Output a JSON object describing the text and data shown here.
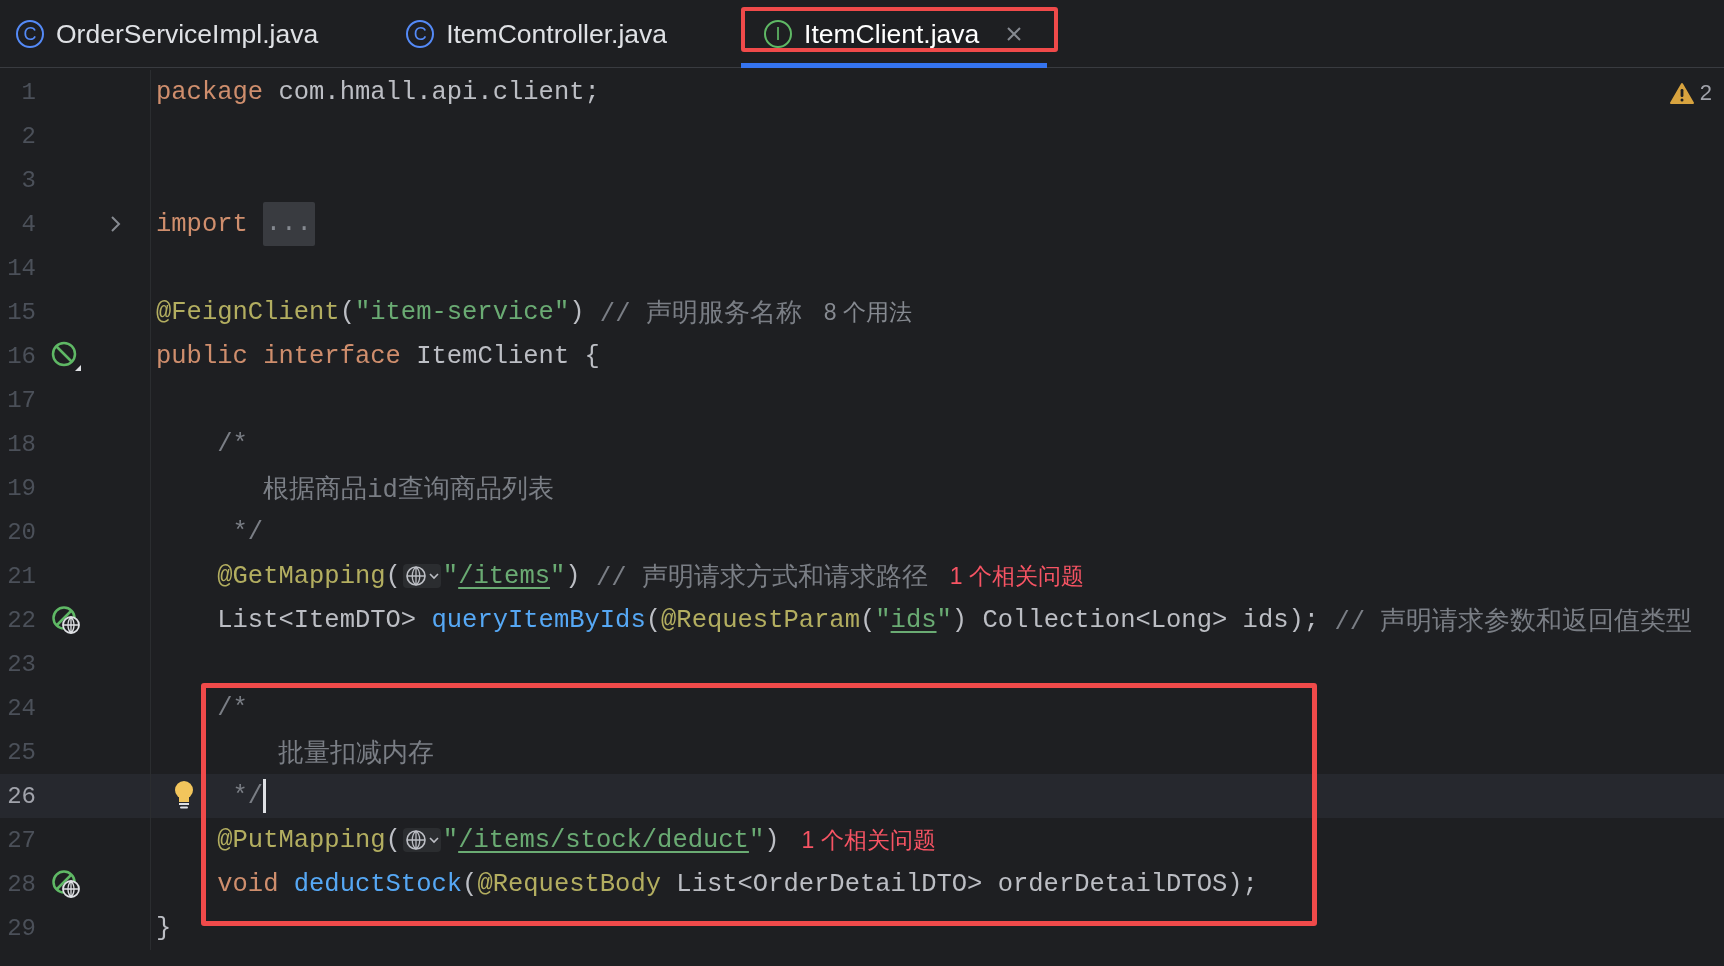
{
  "tabs": [
    {
      "kind": "class",
      "icon_letter": "C",
      "label": "OrderServiceImpl.java",
      "selected": false,
      "closable": false,
      "framed": false
    },
    {
      "kind": "class",
      "icon_letter": "C",
      "label": "ItemController.java",
      "selected": false,
      "closable": false,
      "framed": false
    },
    {
      "kind": "interface",
      "icon_letter": "I",
      "label": "ItemClient.java",
      "selected": true,
      "closable": true,
      "framed": true
    }
  ],
  "editor": {
    "warnings": "2",
    "lines": [
      {
        "number": "1",
        "current": false,
        "tokens": [
          {
            "kind": "keyword",
            "text": "package"
          },
          {
            "kind": "plain",
            "text": " com.hmall.api.client;"
          }
        ]
      },
      {
        "number": "2",
        "current": false
      },
      {
        "number": "3",
        "current": false
      },
      {
        "number": "4",
        "current": false,
        "collapsed": true,
        "tokens": [
          {
            "kind": "keyword",
            "text": "import"
          },
          {
            "kind": "folded",
            "text": "..."
          }
        ]
      },
      {
        "number": "14",
        "current": false
      },
      {
        "number": "15",
        "current": false,
        "tokens": [
          {
            "kind": "annotation",
            "text": "@FeignClient"
          },
          {
            "kind": "plain",
            "text": "("
          },
          {
            "kind": "string",
            "text": "\"item-service\""
          },
          {
            "kind": "plain",
            "text": ")"
          },
          {
            "kind": "comment",
            "text": " // 声明服务名称"
          },
          {
            "kind": "inlay",
            "text": "8 个用法"
          }
        ]
      },
      {
        "number": "16",
        "current": false,
        "kind": "bean",
        "tokens": [
          {
            "kind": "keyword",
            "text": "public"
          },
          {
            "kind": "keyword",
            "text": " interface"
          },
          {
            "kind": "plain",
            "text": " ItemClient {"
          }
        ]
      },
      {
        "number": "17",
        "current": false
      },
      {
        "number": "18",
        "current": false,
        "tokens": [
          {
            "kind": "comment",
            "text": "    /*"
          }
        ]
      },
      {
        "number": "19",
        "current": false,
        "tokens": [
          {
            "kind": "comment",
            "text": "       根据商品id查询商品列表"
          }
        ]
      },
      {
        "number": "20",
        "current": false,
        "tokens": [
          {
            "kind": "comment",
            "text": "     */"
          }
        ]
      },
      {
        "number": "21",
        "current": false,
        "tokens": [
          {
            "kind": "annotation",
            "text": "    @GetMapping"
          },
          {
            "kind": "plain",
            "text": "("
          },
          {
            "kind": "globe"
          },
          {
            "kind": "string",
            "text": "\""
          },
          {
            "kind": "url",
            "text": "/items"
          },
          {
            "kind": "string",
            "text": "\""
          },
          {
            "kind": "plain",
            "text": ")"
          },
          {
            "kind": "comment",
            "text": " // 声明请求方式和请求路径"
          },
          {
            "kind": "problem",
            "text": "1 个相关问题"
          }
        ]
      },
      {
        "number": "22",
        "current": false,
        "kind": "endpoint",
        "tokens": [
          {
            "kind": "plain",
            "text": "    List<ItemDTO> "
          },
          {
            "kind": "method",
            "text": "queryItemByIds"
          },
          {
            "kind": "plain",
            "text": "("
          },
          {
            "kind": "annotation",
            "text": "@RequestParam"
          },
          {
            "kind": "plain",
            "text": "("
          },
          {
            "kind": "string",
            "text": "\""
          },
          {
            "kind": "url",
            "text": "ids"
          },
          {
            "kind": "string",
            "text": "\""
          },
          {
            "kind": "plain",
            "text": ") Collection<Long> ids);"
          },
          {
            "kind": "comment",
            "text": " // 声明请求参数和返回值类型"
          }
        ]
      },
      {
        "number": "23",
        "current": false
      },
      {
        "kind": "group",
        "framed": true,
        "lines": [
          {
            "number": "24",
            "current": false,
            "tokens": [
              {
                "kind": "comment",
                "text": "    /*"
              }
            ]
          },
          {
            "number": "25",
            "current": false,
            "tokens": [
              {
                "kind": "comment",
                "text": "        批量扣减内存"
              }
            ]
          },
          {
            "number": "26",
            "current": true,
            "kind": "bulb",
            "tokens": [
              {
                "kind": "comment",
                "text": "     */"
              }
            ]
          },
          {
            "number": "27",
            "current": false,
            "tokens": [
              {
                "kind": "annotation",
                "text": "    @PutMapping"
              },
              {
                "kind": "plain",
                "text": "("
              },
              {
                "kind": "globe"
              },
              {
                "kind": "string",
                "text": "\""
              },
              {
                "kind": "url",
                "text": "/items/stock/deduct"
              },
              {
                "kind": "string",
                "text": "\""
              },
              {
                "kind": "plain",
                "text": ")"
              },
              {
                "kind": "problem",
                "text": "1 个相关问题"
              }
            ]
          },
          {
            "number": "28",
            "current": false,
            "kind": "endpoint",
            "tokens": [
              {
                "kind": "keyword",
                "text": "    void"
              },
              {
                "kind": "method",
                "text": " deductStock"
              },
              {
                "kind": "plain",
                "text": "("
              },
              {
                "kind": "annotation",
                "text": "@RequestBody"
              },
              {
                "kind": "plain",
                "text": " List<OrderDetailDTO> orderDetailDTOS);"
              }
            ]
          }
        ]
      },
      {
        "number": "29",
        "current": false,
        "tokens": [
          {
            "kind": "plain",
            "text": "}"
          }
        ]
      }
    ]
  }
}
